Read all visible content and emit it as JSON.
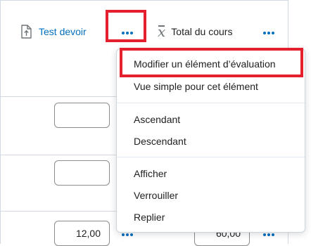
{
  "header": {
    "test_column_label": "Test devoir",
    "total_column_label": "Total du cours",
    "test_icon": "upload-document-icon",
    "total_icon": "x-bar-mean-icon",
    "more_icon": "ellipsis-icon"
  },
  "grades": {
    "row1_value": "",
    "row2_value": "",
    "row3_test_value": "12,00",
    "row3_total_value": "60,00"
  },
  "context_menu": {
    "items": [
      "Modifier un élément d’évaluation",
      "Vue simple pour cet élément",
      "Ascendant",
      "Descendant",
      "Afficher",
      "Verrouiller",
      "Replier"
    ]
  },
  "colors": {
    "link": "#006fbf",
    "highlight": "#e5202e",
    "text": "#202122"
  }
}
